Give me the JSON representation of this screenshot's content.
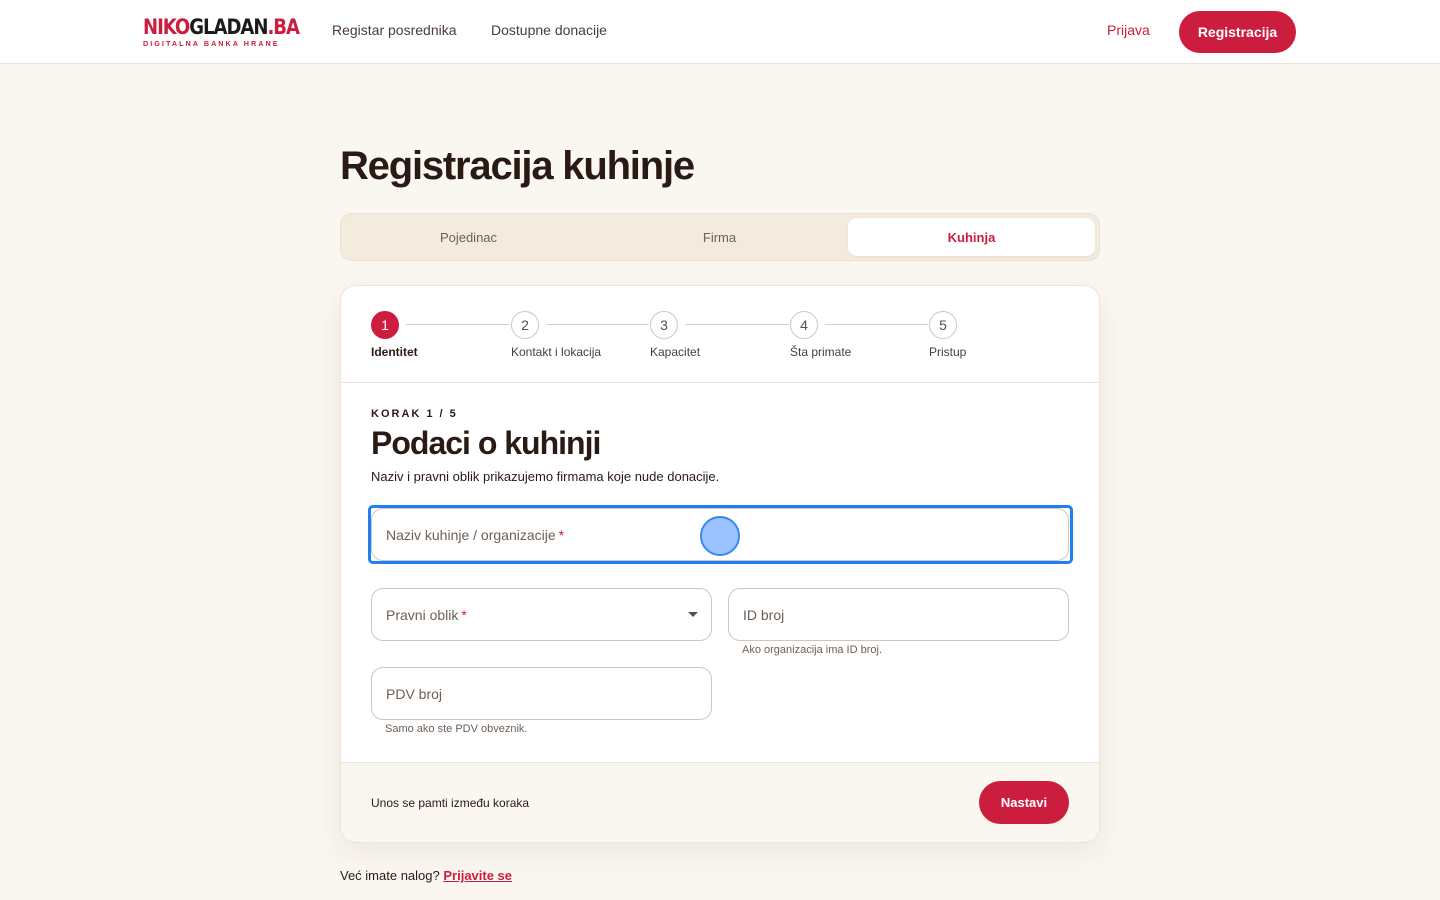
{
  "header": {
    "logo": {
      "part_red": "NIKO",
      "part_dark": "GLADAN",
      "part_red_end": ".BA",
      "tagline": "DIGITALNA BANKA HRANE"
    },
    "nav": [
      {
        "label": "Registar posrednika"
      },
      {
        "label": "Dostupne donacije"
      }
    ],
    "login_label": "Prijava",
    "register_label": "Registracija"
  },
  "page": {
    "title": "Registracija kuhinje"
  },
  "tabs": [
    {
      "label": "Pojedinac",
      "active": false
    },
    {
      "label": "Firma",
      "active": false
    },
    {
      "label": "Kuhinja",
      "active": true
    }
  ],
  "stepper": [
    {
      "number": "1",
      "label": "Identitet",
      "active": true
    },
    {
      "number": "2",
      "label": "Kontakt i lokacija",
      "active": false
    },
    {
      "number": "3",
      "label": "Kapacitet",
      "active": false
    },
    {
      "number": "4",
      "label": "Šta primate",
      "active": false
    },
    {
      "number": "5",
      "label": "Pristup",
      "active": false
    }
  ],
  "form": {
    "kicker": "KORAK 1 / 5",
    "title": "Podaci o kuhinji",
    "description": "Naziv i pravni oblik prikazujemo firmama koje nude donacije.",
    "fields": {
      "name": {
        "label": "Naziv kuhinje / organizacije",
        "required": "*"
      },
      "legal_form": {
        "label": "Pravni oblik",
        "required": "*"
      },
      "id_number": {
        "label": "ID broj",
        "hint": "Ako organizacija ima ID broj."
      },
      "vat_number": {
        "label": "PDV broj",
        "hint": "Samo ako ste PDV obveznik."
      }
    }
  },
  "footer": {
    "note": "Unos se pamti između koraka",
    "continue_label": "Nastavi"
  },
  "bottom": {
    "question": "Već imate nalog?",
    "link_label": "Prijavite se"
  },
  "colors": {
    "accent": "#cc1d3f",
    "background": "#faf6f0",
    "focus": "#2180f0"
  }
}
